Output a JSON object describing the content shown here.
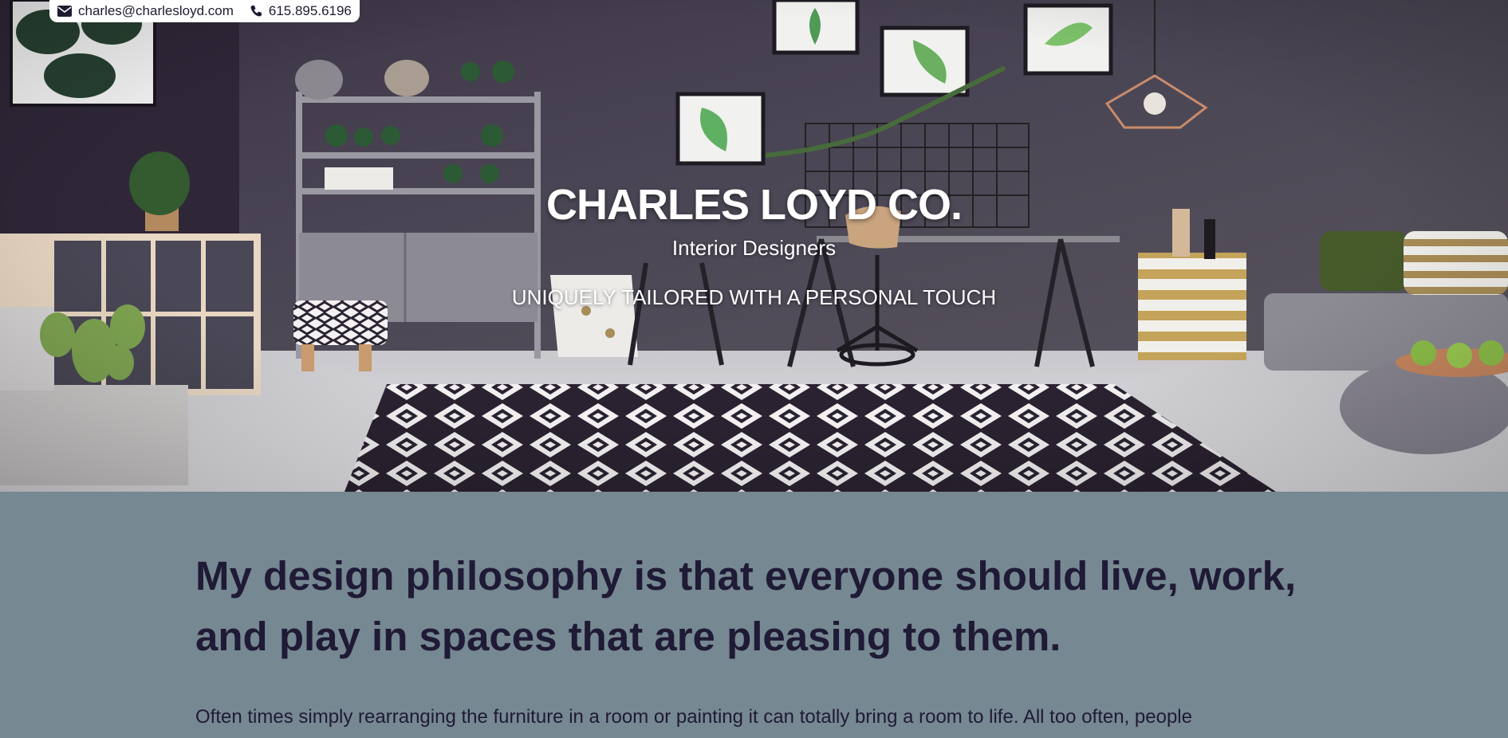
{
  "contact": {
    "email": "charles@charlesloyd.com",
    "phone": "615.895.6196",
    "email_icon": "envelope-icon",
    "phone_icon": "phone-icon"
  },
  "hero": {
    "title": "CHARLES LOYD CO.",
    "subtitle": "Interior Designers",
    "tagline": "UNIQUELY TAILORED WITH A PERSONAL TOUCH"
  },
  "philosophy": {
    "heading": "My design philosophy is that everyone should live, work, and play in spaces that are pleasing to them.",
    "body": "Often times simply rearranging the furniture in a room or painting it can totally bring a room to life. All too often, people"
  },
  "colors": {
    "section_bg": "#768891",
    "text_dark": "#1f1a36",
    "hero_text": "#ffffff"
  }
}
